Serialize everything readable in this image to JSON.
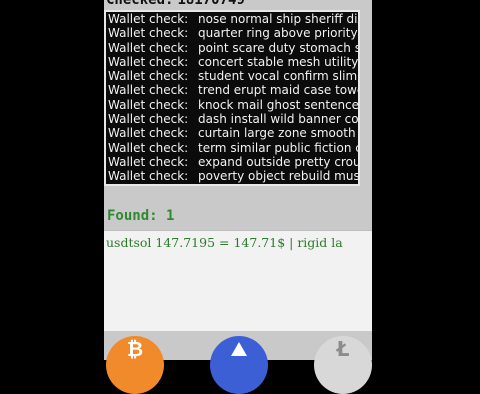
{
  "header": {
    "checked_label": "Checked:",
    "checked_count": "18170749"
  },
  "log": {
    "prefix": "Wallet check:",
    "entries": [
      "nose normal ship sheriff dizz",
      "quarter ring above priority s",
      "point scare duty stomach st",
      "concert stable mesh utility e",
      "student vocal confirm slim c",
      "trend erupt maid case towe",
      "knock mail ghost sentence v",
      "dash install wild banner core",
      "curtain large zone smooth o",
      "term similar public fiction cy",
      "expand outside pretty crou",
      "poverty object rebuild mush"
    ]
  },
  "found": {
    "label": "Found: 1"
  },
  "result": {
    "line": "usdtsol 147.7195 = 147.71$ | rigid la"
  },
  "coins": {
    "btc_symbol": "₿",
    "ltc_symbol": "Ł",
    "colors": {
      "btc": "#f08a2a",
      "eth": "#3d5fd6",
      "ltc": "#d8d8d8"
    }
  }
}
